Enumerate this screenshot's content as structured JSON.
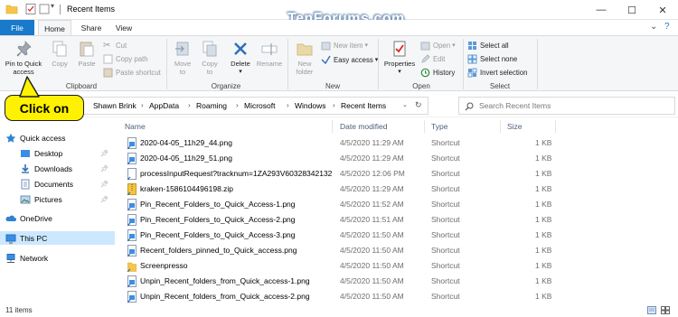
{
  "window": {
    "title": "Recent Items",
    "watermark": "TenForums.com",
    "controls": [
      "—",
      "☐",
      "✕"
    ]
  },
  "ribbon_tabs": {
    "file": "File",
    "home": "Home",
    "share": "Share",
    "view": "View"
  },
  "ribbon": {
    "clipboard": {
      "label": "Clipboard",
      "pin_line1": "Pin to Quick",
      "pin_line2": "access",
      "copy": "Copy",
      "paste": "Paste",
      "cut": "Cut",
      "copy_path": "Copy path",
      "paste_shortcut": "Paste shortcut"
    },
    "organize": {
      "label": "Organize",
      "move_line1": "Move",
      "move_line2": "to",
      "copy_line1": "Copy",
      "copy_line2": "to",
      "delete": "Delete",
      "rename": "Rename"
    },
    "new": {
      "label": "New",
      "new_folder_line1": "New",
      "new_folder_line2": "folder",
      "new_item": "New item",
      "easy_access": "Easy access"
    },
    "open": {
      "label": "Open",
      "properties": "Properties",
      "open": "Open",
      "edit": "Edit",
      "history": "History"
    },
    "select": {
      "label": "Select",
      "select_all": "Select all",
      "select_none": "Select none",
      "invert_selection": "Invert selection"
    }
  },
  "address": {
    "crumbs": [
      "Shawn Brink",
      "AppData",
      "Roaming",
      "Microsoft",
      "Windows",
      "Recent Items"
    ],
    "search_placeholder": "Search Recent Items"
  },
  "callout": {
    "text": "Click on",
    "color": "#fff200"
  },
  "nav": {
    "quick_access": "Quick access",
    "desktop": "Desktop",
    "downloads": "Downloads",
    "documents": "Documents",
    "pictures": "Pictures",
    "onedrive": "OneDrive",
    "this_pc": "This PC",
    "network": "Network"
  },
  "columns": {
    "name": "Name",
    "date": "Date modified",
    "type": "Type",
    "size": "Size"
  },
  "files": [
    {
      "name": "2020-04-05_11h29_44.png",
      "date": "4/5/2020 11:29 AM",
      "type": "Shortcut",
      "size": "1 KB",
      "icon": "png-shortcut-icon"
    },
    {
      "name": "2020-04-05_11h29_51.png",
      "date": "4/5/2020 11:29 AM",
      "type": "Shortcut",
      "size": "1 KB",
      "icon": "png-shortcut-icon"
    },
    {
      "name": "processInputRequest?tracknum=1ZA293V60328342132",
      "date": "4/5/2020 12:06 PM",
      "type": "Shortcut",
      "size": "1 KB",
      "icon": "blank-shortcut-icon"
    },
    {
      "name": "kraken-1586104496198.zip",
      "date": "4/5/2020 11:29 AM",
      "type": "Shortcut",
      "size": "1 KB",
      "icon": "zip-shortcut-icon"
    },
    {
      "name": "Pin_Recent_Folders_to_Quick_Access-1.png",
      "date": "4/5/2020 11:52 AM",
      "type": "Shortcut",
      "size": "1 KB",
      "icon": "png-shortcut-icon"
    },
    {
      "name": "Pin_Recent_Folders_to_Quick_Access-2.png",
      "date": "4/5/2020 11:51 AM",
      "type": "Shortcut",
      "size": "1 KB",
      "icon": "png-shortcut-icon"
    },
    {
      "name": "Pin_Recent_Folders_to_Quick_Access-3.png",
      "date": "4/5/2020 11:50 AM",
      "type": "Shortcut",
      "size": "1 KB",
      "icon": "png-shortcut-icon"
    },
    {
      "name": "Recent_folders_pinned_to_Quick_access.png",
      "date": "4/5/2020 11:50 AM",
      "type": "Shortcut",
      "size": "1 KB",
      "icon": "png-shortcut-icon"
    },
    {
      "name": "Screenpresso",
      "date": "4/5/2020 11:50 AM",
      "type": "Shortcut",
      "size": "1 KB",
      "icon": "folder-shortcut-icon"
    },
    {
      "name": "Unpin_Recent_folders_from_Quick_access-1.png",
      "date": "4/5/2020 11:50 AM",
      "type": "Shortcut",
      "size": "1 KB",
      "icon": "png-shortcut-icon"
    },
    {
      "name": "Unpin_Recent_folders_from_Quick_access-2.png",
      "date": "4/5/2020 11:50 AM",
      "type": "Shortcut",
      "size": "1 KB",
      "icon": "png-shortcut-icon"
    }
  ],
  "status": {
    "items": "11 items"
  },
  "colors": {
    "accent": "#1979ca",
    "selection": "#cce8ff",
    "header_text": "#4c607a"
  }
}
